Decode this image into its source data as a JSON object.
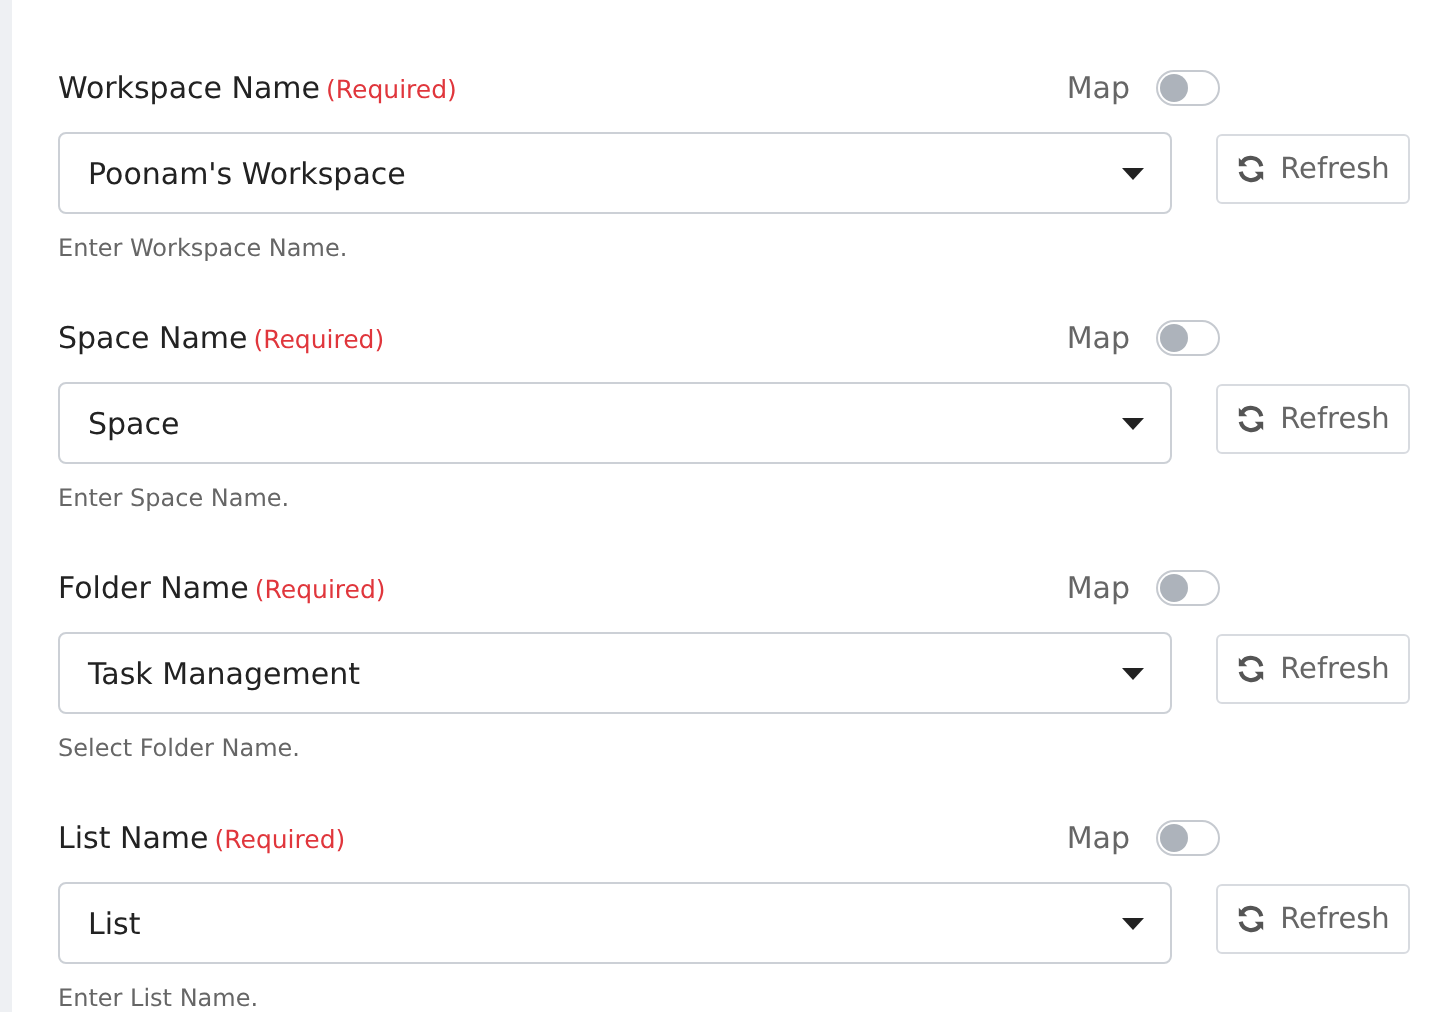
{
  "fields": [
    {
      "label": "Workspace Name",
      "required": "(Required)",
      "map_label": "Map",
      "map_on": false,
      "value": "Poonam's Workspace",
      "refresh": "Refresh",
      "help": "Enter Workspace Name."
    },
    {
      "label": "Space Name",
      "required": "(Required)",
      "map_label": "Map",
      "map_on": false,
      "value": "Space",
      "refresh": "Refresh",
      "help": "Enter Space Name."
    },
    {
      "label": "Folder Name",
      "required": "(Required)",
      "map_label": "Map",
      "map_on": false,
      "value": "Task Management",
      "refresh": "Refresh",
      "help": "Select Folder Name."
    },
    {
      "label": "List Name",
      "required": "(Required)",
      "map_label": "Map",
      "map_on": false,
      "value": "List",
      "refresh": "Refresh",
      "help": "Enter List Name."
    }
  ]
}
